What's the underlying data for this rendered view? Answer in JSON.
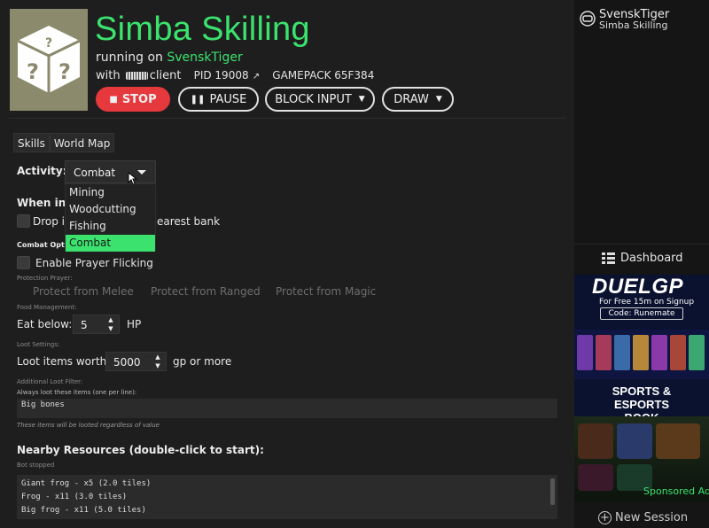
{
  "header": {
    "title": "Simba Skilling",
    "running_prefix": "running on",
    "account": "SvenskTiger",
    "with_prefix": "with",
    "client_suffix": "client",
    "pid": "PID 19008",
    "gamepack": "GAMEPACK 65F384"
  },
  "controls": {
    "stop": "STOP",
    "pause": "PAUSE",
    "block_input": "BLOCK INPUT",
    "draw": "DRAW"
  },
  "tabs": [
    "Skills",
    "World Map"
  ],
  "activity": {
    "label": "Activity:",
    "selected": "Combat",
    "options": [
      "Mining",
      "Woodcutting",
      "Fishing",
      "Combat"
    ]
  },
  "inventory": {
    "heading": "When inve",
    "drop_prefix": "Drop it",
    "drop_suffix": "earest bank"
  },
  "combat": {
    "heading": "Combat Opti",
    "prayer_flicking": "Enable Prayer Flicking",
    "protection_label": "Protection Prayer:",
    "protect_melee": "Protect from Melee",
    "protect_ranged": "Protect from Ranged",
    "protect_magic": "Protect from Magic"
  },
  "food": {
    "heading": "Food Management:",
    "eat_label": "Eat below:",
    "eat_value": "5",
    "unit": "HP"
  },
  "loot": {
    "heading": "Loot Settings:",
    "worth_label": "Loot items worth:",
    "worth_value": "5000",
    "unit": "gp or more",
    "filter_heading": "Additional Loot Filter:",
    "always_label": "Always loot these items (one per line):",
    "items_text": "Big bones",
    "note": "These items will be looted regardless of value"
  },
  "resources": {
    "heading": "Nearby Resources (double-click to start):",
    "status": "Bot stopped",
    "list": [
      "Giant frog - x5 (2.0 tiles)",
      "Frog - x11 (3.0 tiles)",
      "Big frog - x11 (5.0 tiles)"
    ]
  },
  "sidebar": {
    "account": "SvenskTiger",
    "script": "Simba Skilling",
    "dashboard": "Dashboard",
    "new_session": "New Session"
  },
  "ad": {
    "brand_a": "DUEL",
    "brand_b": "GP",
    "offer": "For Free 15m on Signup",
    "code": "Code: Runemate",
    "headline_1": "SPORTS & ESPORTS",
    "headline_2": "BOOK",
    "sponsored": "Sponsored Ad"
  },
  "colors": {
    "accent": "#3be36e",
    "stop": "#e6393d",
    "background": "#1e1e1e",
    "sidebar": "#151515"
  }
}
